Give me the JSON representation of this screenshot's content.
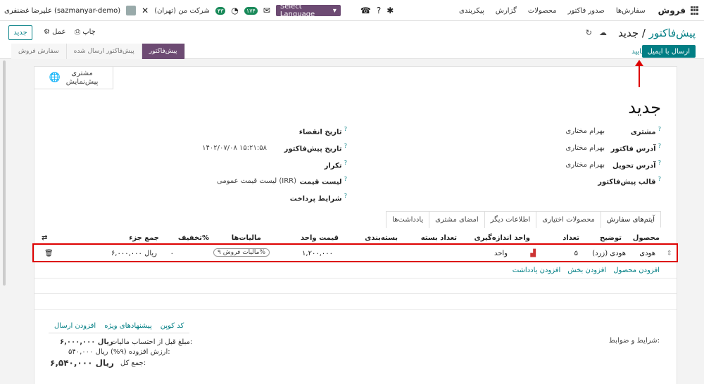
{
  "navbar": {
    "brand": "فروش",
    "menu": [
      "سفارش‌ها",
      "صدور فاکتور",
      "محصولات",
      "گزارش",
      "پیکربندی"
    ],
    "user": "علیرضا غضنفری (sazmanyar-demo)",
    "company": "شرکت من (تهران)",
    "activity_badge": "۴۳",
    "message_badge": "۱۷۴",
    "language_select": "Select Language"
  },
  "control": {
    "new_button": "جدید",
    "action_label": "عمل",
    "print_label": "چاپ",
    "breadcrumb_parent": "پیش‌فاکتور",
    "breadcrumb_sep": "/",
    "breadcrumb_current": "جدید",
    "send_email_button": "ارسال با ایمیل",
    "confirm_button": "تایید",
    "statuses": [
      "سفارش فروش",
      "پیش‌فاکتور ارسال شده",
      "پیش‌فاکتور"
    ]
  },
  "sheet": {
    "stat_customer": "مشتری",
    "stat_preview": "پیش‌نمایش",
    "title": "جدید",
    "fields_right": [
      {
        "label": "مشتری",
        "value": "بهرام مختاری"
      },
      {
        "label": "آدرس فاکتور",
        "value": "بهرام مختاری"
      },
      {
        "label": "آدرس تحویل",
        "value": "بهرام مختاری"
      },
      {
        "label": "قالب پیش‌فاکتور",
        "value": ""
      }
    ],
    "fields_left": [
      {
        "label": "تاریخ انقضاء",
        "value": ""
      },
      {
        "label": "تاریخ پیش‌فاکتور",
        "value": "۱۴۰۲/۰۷/۰۸ ۱۵:۲۱:۵۸"
      },
      {
        "label": "تکرار",
        "value": ""
      },
      {
        "label": "لیست قیمت",
        "value": "لیست قیمت عمومی (IRR)"
      },
      {
        "label": "شرایط پرداخت",
        "value": ""
      }
    ],
    "tabs": [
      "آیتم‌های سفارش",
      "محصولات اختیاری",
      "اطلاعات دیگر",
      "امضای مشتری",
      "یادداشت‌ها"
    ]
  },
  "table": {
    "headers": {
      "product": "محصول",
      "description": "توضیح",
      "qty": "تعداد",
      "uom": "واحد اندازه‌گیری",
      "pkg_qty": "تعداد بسته",
      "packaging": "بسته‌بندی",
      "price": "قیمت واحد",
      "taxes": "مالیات‌ها",
      "discount": "تخفیف%",
      "subtotal": "جمع جزء"
    },
    "row": {
      "product": "هودی",
      "description": "هودی (زرد)",
      "qty": "۵",
      "uom": "واحد",
      "price": "۱,۲۰۰,۰۰۰",
      "tax": "مالیات فروش ۹%",
      "discount": "۰",
      "subtotal": "ریال ۶,۰۰۰,۰۰۰"
    },
    "add_product": "افزودن محصول",
    "add_section": "افزودن بخش",
    "add_note": "افزودن یادداشت"
  },
  "totals": {
    "coupon": "کد کوپن",
    "promotions": "پیشنهادهای ویژه",
    "add_shipping": "افزودن ارسال",
    "untaxed_label": "مبلغ قبل از احتساب مالیات:",
    "untaxed_value": "ریال ۶,۰۰۰,۰۰۰",
    "vat_label": "ارزش افزوده (۹%):",
    "vat_value": "ریال ۵۴۰,۰۰۰",
    "total_label": "جمع کل:",
    "total_value": "ریال ۶,۵۴۰,۰۰۰",
    "terms_label": "شرایط و ضوابط:"
  }
}
